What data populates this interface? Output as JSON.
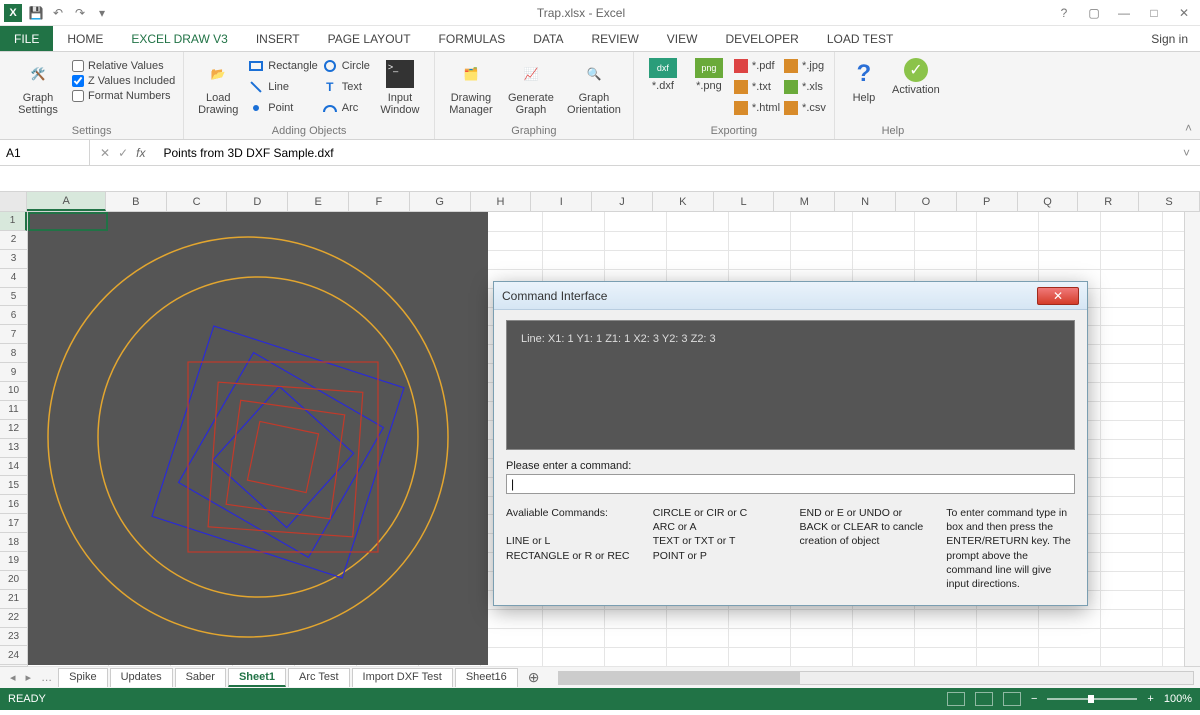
{
  "title": "Trap.xlsx - Excel",
  "signin": "Sign in",
  "tabs": [
    "FILE",
    "HOME",
    "EXCEL DRAW v3",
    "INSERT",
    "PAGE LAYOUT",
    "FORMULAS",
    "DATA",
    "REVIEW",
    "VIEW",
    "DEVELOPER",
    "LOAD TEST"
  ],
  "active_tab_index": 2,
  "ribbon": {
    "settings": {
      "label": "Settings",
      "graph_settings": "Graph\nSettings",
      "relative": "Relative Values",
      "zvals": "Z Values Included",
      "fmtnum": "Format Numbers"
    },
    "adding": {
      "label": "Adding Objects",
      "load_drawing": "Load\nDrawing",
      "rectangle": "Rectangle",
      "line": "Line",
      "point": "Point",
      "circle": "Circle",
      "text": "Text",
      "arc": "Arc",
      "input_window": "Input\nWindow"
    },
    "graphing": {
      "label": "Graphing",
      "drawing_mgr": "Drawing\nManager",
      "generate": "Generate\nGraph",
      "orient": "Graph\nOrientation"
    },
    "exporting": {
      "label": "Exporting",
      "dxf": "*.dxf",
      "png": "*.png",
      "pdf": "*.pdf",
      "txt": "*.txt",
      "html": "*.html",
      "jpg": "*.jpg",
      "xls": "*.xls",
      "csv": "*.csv"
    },
    "help": {
      "label": "Help",
      "help": "Help",
      "activation": "Activation"
    }
  },
  "namebox": "A1",
  "formula": "Points from 3D DXF Sample.dxf",
  "columns": [
    "A",
    "B",
    "C",
    "D",
    "E",
    "F",
    "G",
    "H",
    "I",
    "J",
    "K",
    "L",
    "M",
    "N",
    "O",
    "P",
    "Q",
    "R",
    "S"
  ],
  "rows": 24,
  "dialog": {
    "title": "Command Interface",
    "log": "Line: X1: 1 Y1: 1 Z1: 1 X2: 3 Y2: 3 Z2: 3",
    "prompt": "Please enter a command:",
    "value": "|",
    "help_heading": "Avaliable Commands:",
    "help_c1": "LINE or L\nRECTANGLE or R or REC",
    "help_c2": "CIRCLE or CIR or C\nARC or A\nTEXT or TXT or T\nPOINT or P",
    "help_c3": "END or E or UNDO or BACK or CLEAR to cancle creation of object",
    "help_c4": "To enter command type in box and then press the ENTER/RETURN key. The prompt above the command line will give input directions."
  },
  "sheets": [
    "Spike",
    "Updates",
    "Saber",
    "Sheet1",
    "Arc Test",
    "Import DXF Test",
    "Sheet16"
  ],
  "active_sheet_index": 3,
  "status": "READY",
  "zoom": "100%"
}
